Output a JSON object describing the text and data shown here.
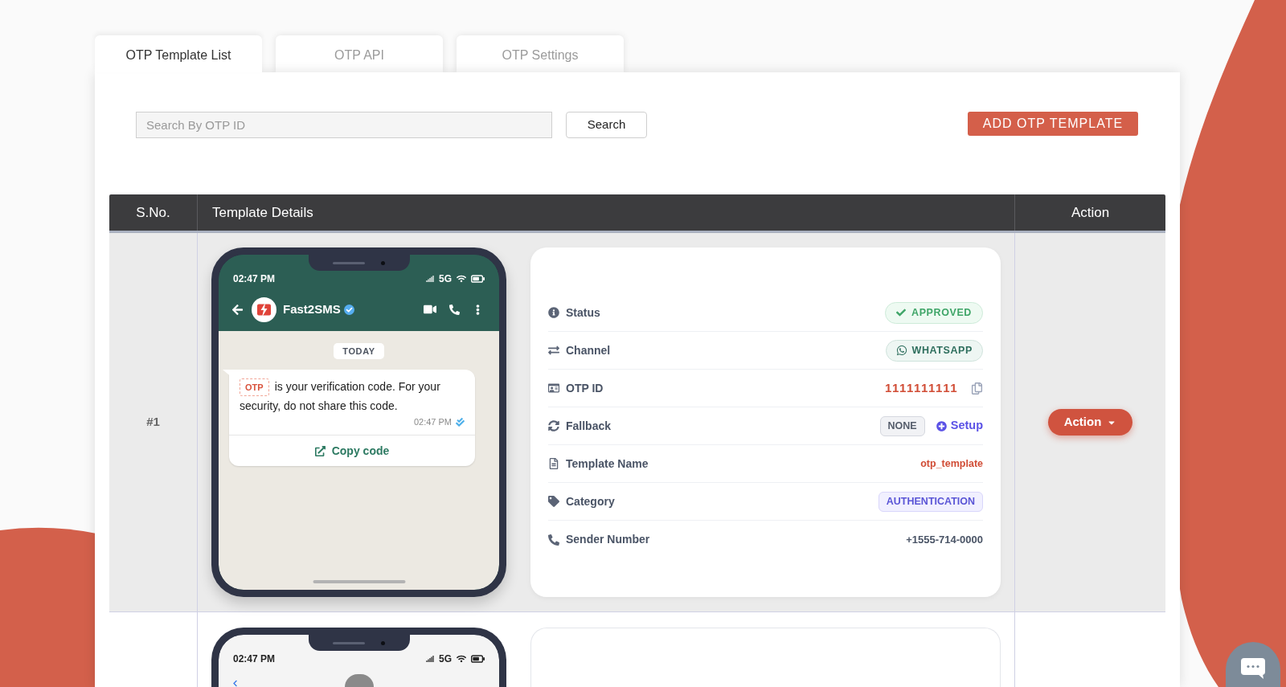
{
  "tabs": [
    {
      "label": "OTP Template List",
      "selected": true
    },
    {
      "label": "OTP API",
      "selected": false
    },
    {
      "label": "OTP Settings",
      "selected": false
    }
  ],
  "search": {
    "placeholder": "Search By OTP ID",
    "button": "Search"
  },
  "add_button": "ADD OTP TEMPLATE",
  "table": {
    "columns": [
      "S.No.",
      "Template Details",
      "Action"
    ],
    "rows": [
      {
        "serial": "#1",
        "preview": {
          "kind": "green",
          "time": "02:47 PM",
          "network": "5G",
          "contact": "Fast2SMS",
          "verified": true,
          "date_label": "TODAY",
          "code_label": "OTP",
          "message": "is your verification code. For your security, do not share this code.",
          "message_time": "02:47 PM",
          "read": true,
          "button": "Copy code"
        },
        "details": [
          {
            "label": "Status",
            "kind": "status",
            "value": "APPROVED"
          },
          {
            "label": "Channel",
            "kind": "channel",
            "value": "WHATSAPP"
          },
          {
            "label": "OTP ID",
            "kind": "id",
            "value": "1111111111"
          },
          {
            "label": "Fallback",
            "kind": "fallback",
            "value": "NONE",
            "link": "Setup"
          },
          {
            "label": "Template Name",
            "kind": "name",
            "value": "otp_template"
          },
          {
            "label": "Category",
            "kind": "category",
            "value": "AUTHENTICATION"
          },
          {
            "label": "Sender Number",
            "kind": "phone",
            "value": "+1555-714-0000"
          }
        ],
        "action": "Action"
      },
      {
        "preview": {
          "kind": "light",
          "time": "02:47 PM",
          "network": "5G"
        }
      }
    ]
  }
}
